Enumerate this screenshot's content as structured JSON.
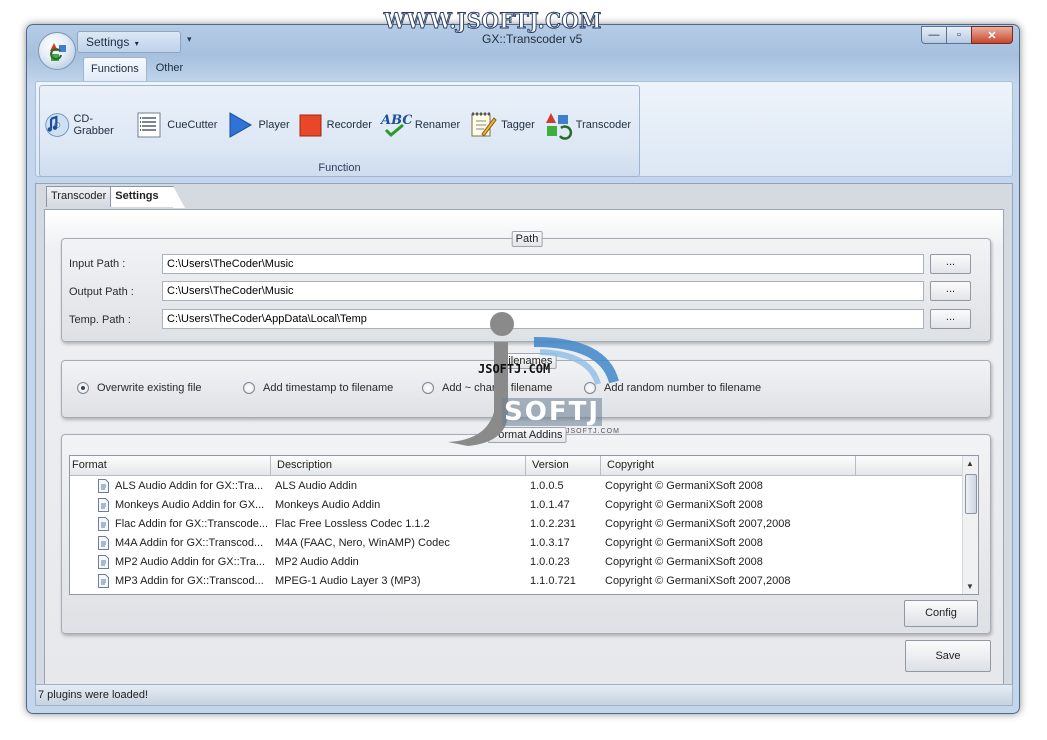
{
  "app": {
    "title": "GX::Transcoder v5",
    "watermark_top": "WWW.JSOFTJ.COM",
    "quick_access": "Settings",
    "window_buttons": [
      "—",
      "▫",
      "✕"
    ]
  },
  "ribbon": {
    "tabs": [
      {
        "label": "Functions",
        "active": true
      },
      {
        "label": "Other",
        "active": false
      }
    ],
    "group_label": "Function",
    "buttons": [
      {
        "label": "CD-Grabber",
        "icon": "cd-music-icon"
      },
      {
        "label": "CueCutter",
        "icon": "cue-list-icon"
      },
      {
        "label": "Player",
        "icon": "play-icon"
      },
      {
        "label": "Recorder",
        "icon": "record-icon"
      },
      {
        "label": "Renamer",
        "icon": "abc-check-icon"
      },
      {
        "label": "Tagger",
        "icon": "notepad-pencil-icon"
      },
      {
        "label": "Transcoder",
        "icon": "transcode-arrows-icon"
      }
    ]
  },
  "doc_tabs": [
    {
      "label": "Transcoder",
      "active": false
    },
    {
      "label": "Settings",
      "active": true
    }
  ],
  "path_panel": {
    "caption": "Path",
    "browse_label": "...",
    "fields": [
      {
        "label": "Input Path :",
        "value": "C:\\Users\\TheCoder\\Music"
      },
      {
        "label": "Output Path :",
        "value": "C:\\Users\\TheCoder\\Music"
      },
      {
        "label": "Temp. Path :",
        "value": "C:\\Users\\TheCoder\\AppData\\Local\\Temp"
      }
    ]
  },
  "filenames_panel": {
    "caption": "Filenames",
    "options": [
      {
        "label": "Overwrite existing file",
        "checked": true
      },
      {
        "label": "Add timestamp to filename",
        "checked": false
      },
      {
        "label": "Add ~ char to filename",
        "checked": false
      },
      {
        "label": "Add random number to filename",
        "checked": false
      }
    ]
  },
  "addins_panel": {
    "caption": "Format Addins",
    "columns": [
      "Format",
      "Description",
      "Version",
      "Copyright"
    ],
    "rows": [
      {
        "format": "ALS Audio Addin for GX::Tra...",
        "description": "ALS Audio Addin",
        "version": "1.0.0.5",
        "copyright": "Copyright © GermaniXSoft 2008"
      },
      {
        "format": "Monkeys Audio Addin for GX...",
        "description": "Monkeys Audio Addin",
        "version": "1.0.1.47",
        "copyright": "Copyright © GermaniXSoft 2008"
      },
      {
        "format": "Flac Addin for GX::Transcode...",
        "description": "Flac Free Lossless Codec 1.1.2",
        "version": "1.0.2.231",
        "copyright": "Copyright © GermaniXSoft 2007,2008"
      },
      {
        "format": "M4A Addin for GX::Transcod...",
        "description": "M4A (FAAC, Nero, WinAMP) Codec",
        "version": "1.0.3.17",
        "copyright": "Copyright © GermaniXSoft 2008"
      },
      {
        "format": "MP2 Audio Addin for GX::Tra...",
        "description": "MP2 Audio Addin",
        "version": "1.0.0.23",
        "copyright": "Copyright © GermaniXSoft 2008"
      },
      {
        "format": "MP3 Addin for GX::Transcod...",
        "description": "MPEG-1 Audio Layer 3 (MP3)",
        "version": "1.1.0.721",
        "copyright": "Copyright © GermaniXSoft 2007,2008"
      }
    ],
    "config_label": "Config"
  },
  "save_label": "Save",
  "status_text": "7 plugins were loaded!",
  "watermark": {
    "text": "JSOFTJ.COM",
    "logo_text": "SOFTJ",
    "small_text": "JSOFTJ.COM"
  }
}
